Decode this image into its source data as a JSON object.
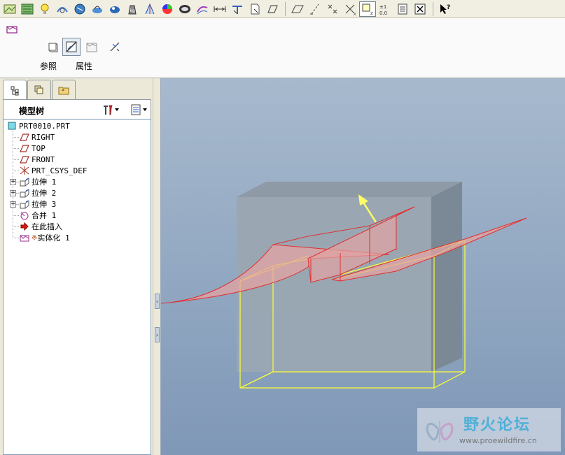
{
  "toolbar": {
    "icons": [
      "datum-display-icon",
      "plane-display-icon",
      "light-icon",
      "spin-center-icon",
      "model-color-icon",
      "appearance-icon",
      "appearance-editor-icon",
      "mass-icon",
      "analysis-icon",
      "curvature-icon",
      "shade-icon",
      "section-icon",
      "measure-icon",
      "sketch-view-icon",
      "view-manager-icon",
      "datum-plane-icon",
      "axis-icon",
      "point-icon",
      "csys-icon",
      "sketch-icon",
      "number-icon",
      "table-icon",
      "close-window-icon",
      "whats-this-icon"
    ]
  },
  "dashboard": {
    "tab_references": "参照",
    "tab_properties": "属性"
  },
  "left_panel": {
    "tree_title": "模型树",
    "items": [
      {
        "label": "PRT0010.PRT"
      },
      {
        "label": "RIGHT"
      },
      {
        "label": "TOP"
      },
      {
        "label": "FRONT"
      },
      {
        "label": "PRT_CSYS_DEF"
      },
      {
        "label": "拉伸 1"
      },
      {
        "label": "拉伸 2"
      },
      {
        "label": "拉伸 3"
      },
      {
        "label": "合并 1"
      },
      {
        "label": "在此插入"
      },
      {
        "label": "实体化 1"
      }
    ]
  },
  "watermark": {
    "title": "野火论坛",
    "url": "www.proewildfire.cn"
  },
  "colors": {
    "viewport_top": "#a7b9cd",
    "viewport_bottom": "#7f98b7",
    "solid_face": "#9aa6b2",
    "highlight_edge": "#ffff33",
    "surface_fill": "#e3a3a3",
    "surface_edge": "#e03030",
    "arrow": "#ffff66"
  }
}
